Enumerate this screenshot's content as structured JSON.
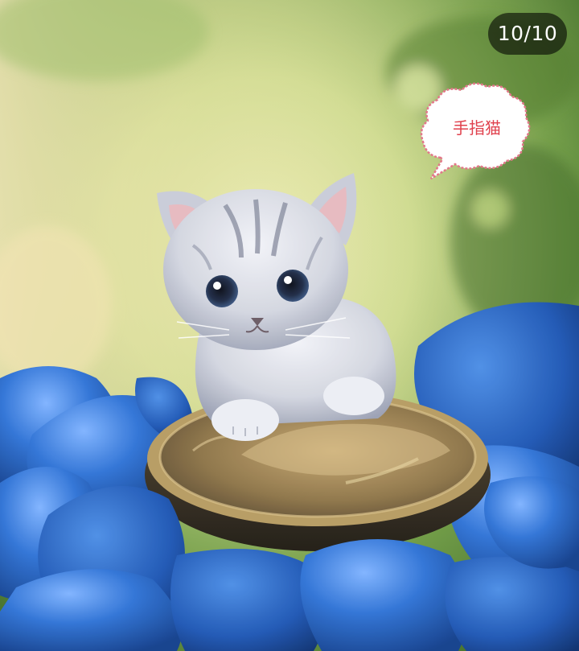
{
  "viewer": {
    "counter": "10/10",
    "sticker": {
      "text": "手指猫",
      "icon": "speech-bubble-cloud-icon"
    },
    "photo": {
      "subject_icon": "kitten-on-coin-photo",
      "colors": {
        "background_green": "#6f9a45",
        "background_yellow": "#e6e39a",
        "stones_blue": "#2b6fd0",
        "coin_gold": "#a38a55",
        "kitten_gray": "#c9ccd6"
      }
    }
  }
}
